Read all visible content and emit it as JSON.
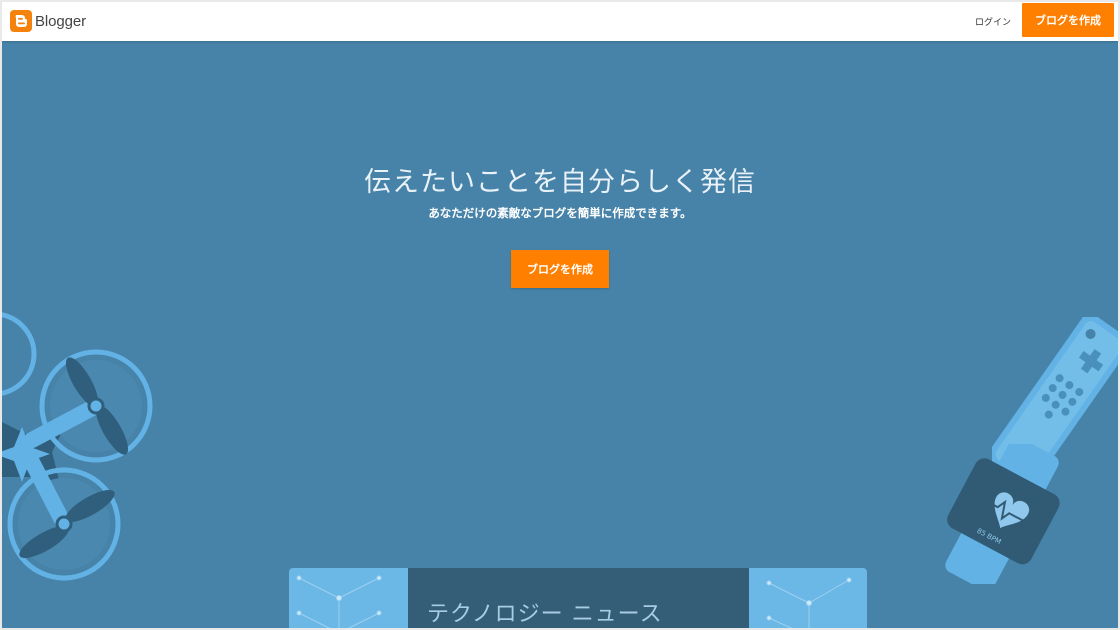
{
  "header": {
    "brand": "Blogger",
    "login_label": "ログイン",
    "create_label": "ブログを作成"
  },
  "hero": {
    "title": "伝えたいことを自分らしく発信",
    "subtitle": "あなただけの素敵なブログを簡単に作成できます。",
    "create_label": "ブログを作成"
  },
  "illustrations": {
    "watch_text": "85 BPM"
  },
  "news_card": {
    "title": "テクノロジー ニュース"
  },
  "colors": {
    "accent": "#ff7f00",
    "background": "#4783a8",
    "illustration": "#63b2e6"
  }
}
